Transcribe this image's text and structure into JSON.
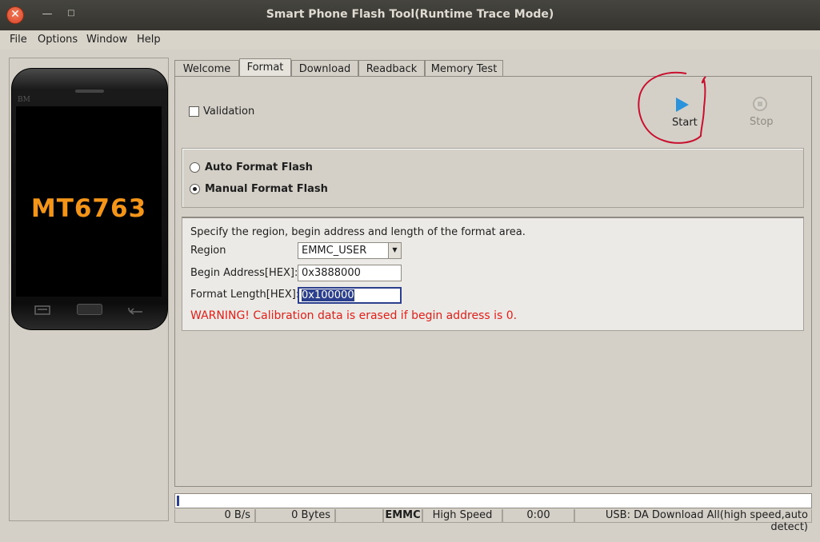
{
  "window": {
    "title": "Smart Phone Flash Tool(Runtime Trace Mode)",
    "close_glyph": "✕",
    "min_glyph": "—",
    "max_glyph": "□"
  },
  "menu": [
    "File",
    "Options",
    "Window",
    "Help"
  ],
  "phone": {
    "brand": "BM",
    "chip": "MT6763"
  },
  "tabs": [
    "Welcome",
    "Format",
    "Download",
    "Readback",
    "Memory Test"
  ],
  "active_tab": "Format",
  "format": {
    "validation_label": "Validation",
    "validation_checked": false,
    "start_label": "Start",
    "stop_label": "Stop",
    "auto_label": "Auto Format Flash",
    "manual_label": "Manual Format Flash",
    "selected_mode": "Manual Format Flash",
    "instructions": "Specify the region, begin address and length of the format area.",
    "region_label": "Region",
    "region_value": "EMMC_USER",
    "begin_label": "Begin Address[HEX]:",
    "begin_value": "0x3888000",
    "length_label": "Format Length[HEX]:",
    "length_value": "0x100000",
    "warning": "WARNING! Calibration data is erased if begin address is 0."
  },
  "status": {
    "speed": "0 B/s",
    "bytes": "0 Bytes",
    "storage": "EMMC",
    "mode": "High Speed",
    "time": "0:00",
    "usb": "USB: DA Download All(high speed,auto detect)"
  },
  "colors": {
    "accent": "#2a93dc",
    "warning": "#e0201a",
    "chip": "#f39519",
    "annotation": "#c8102e"
  }
}
